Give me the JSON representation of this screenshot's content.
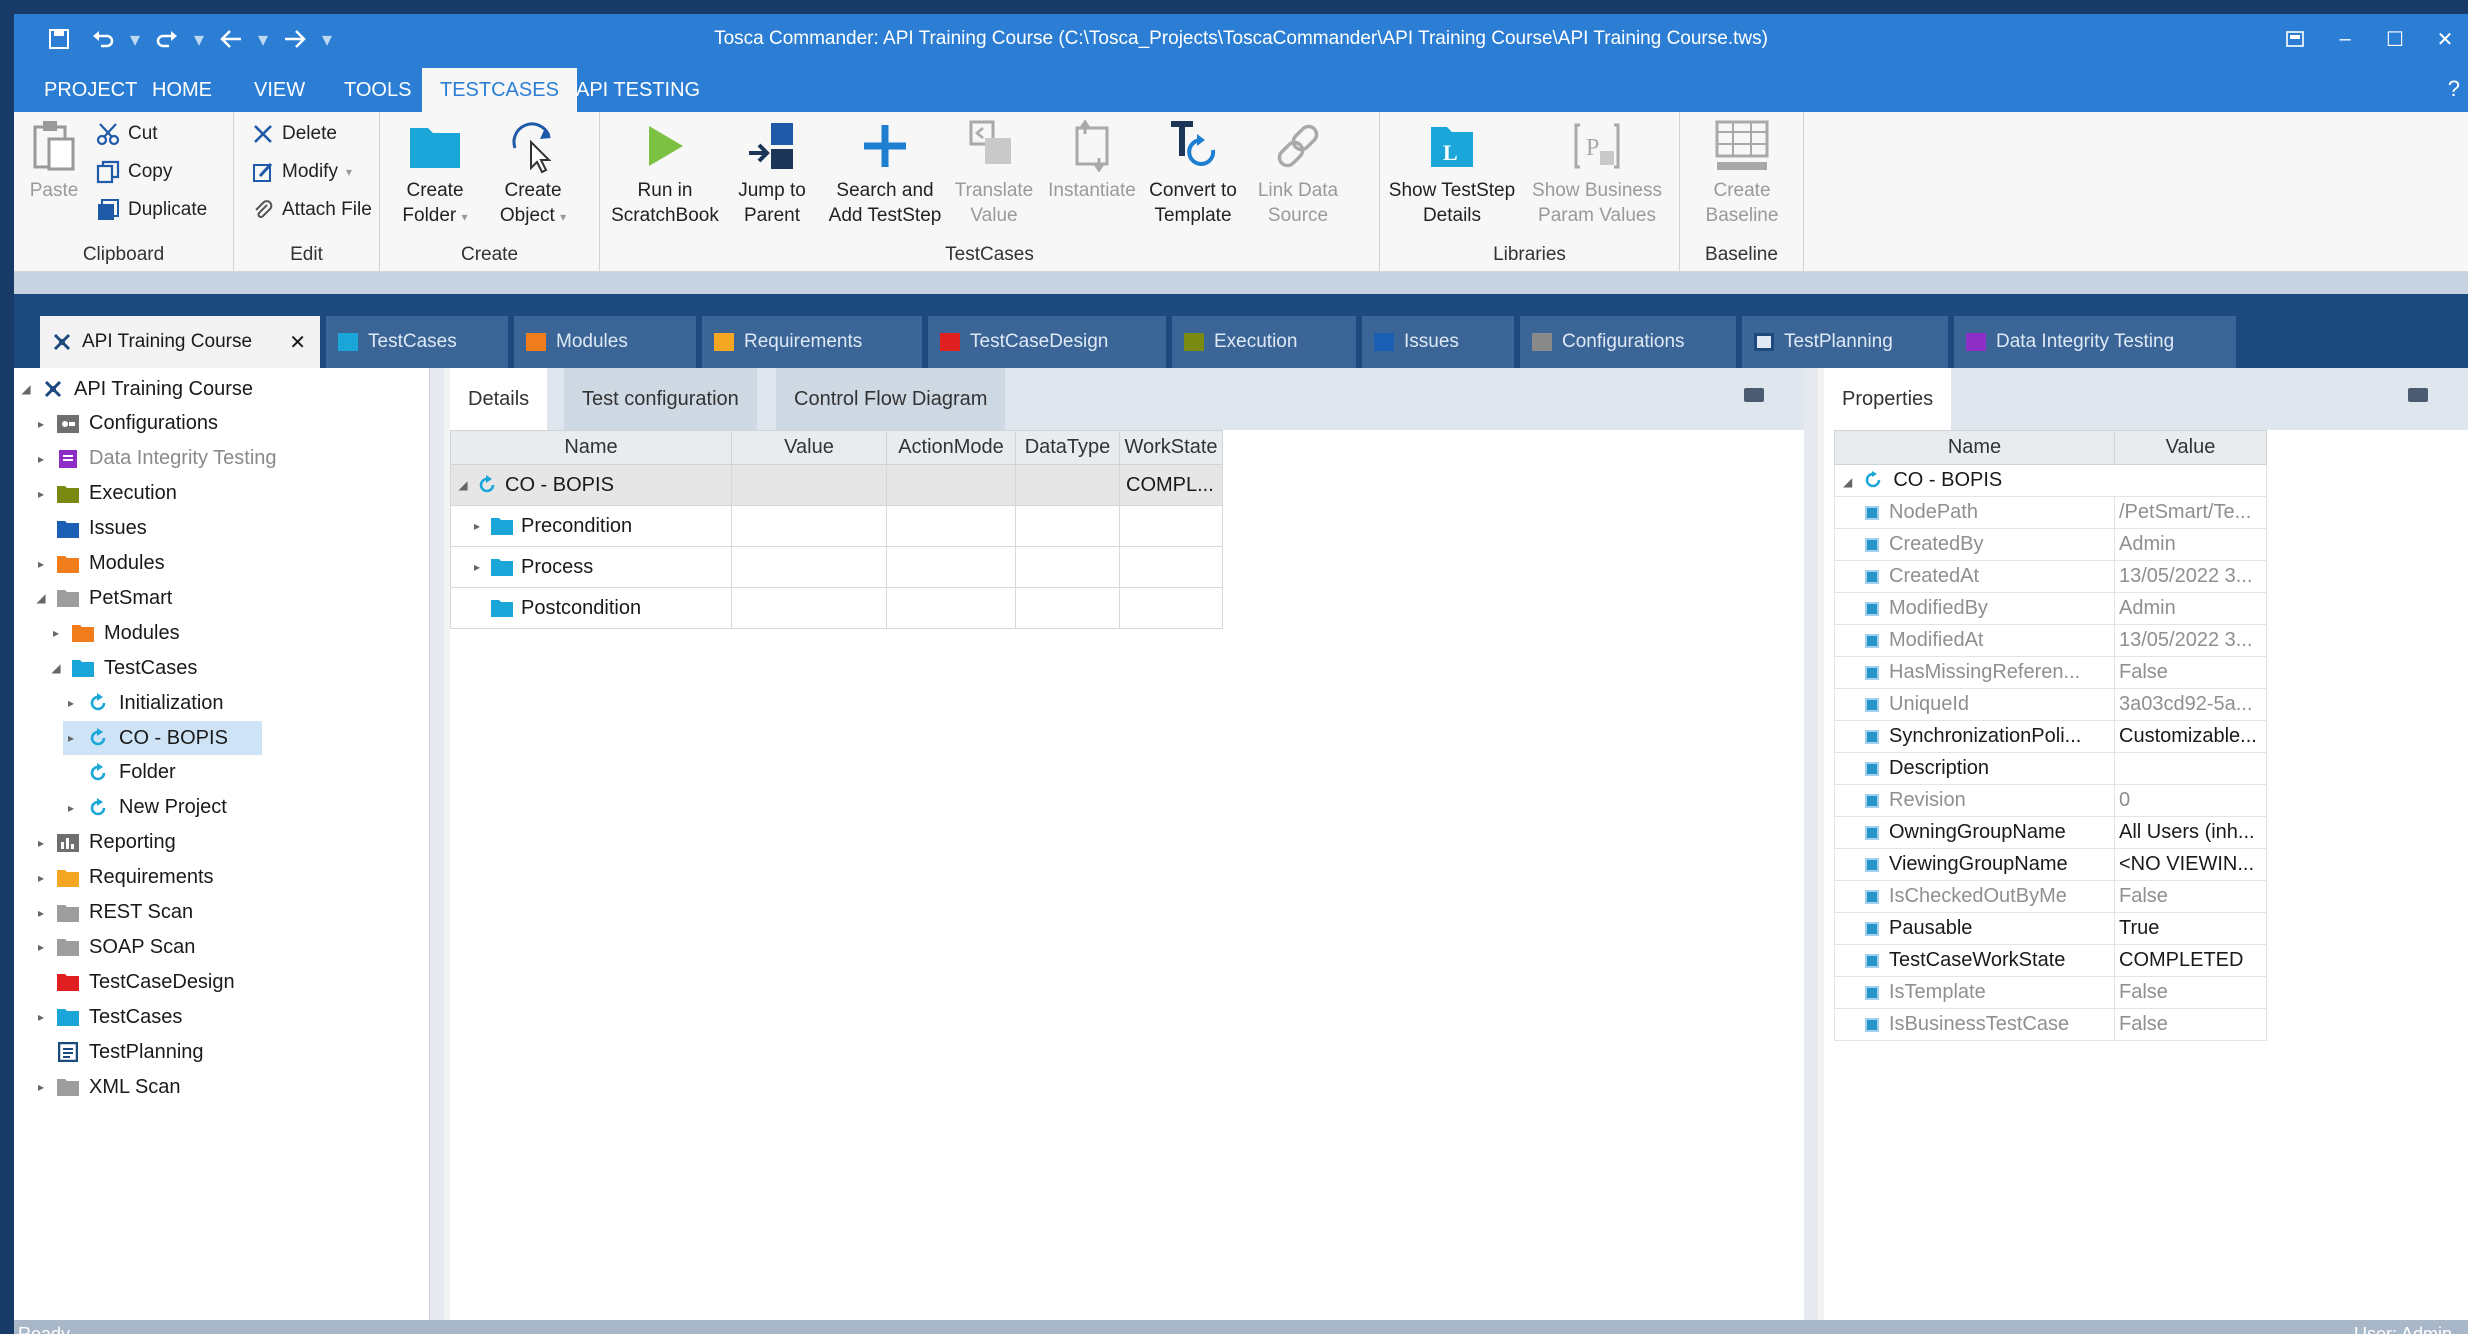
{
  "window": {
    "title": "Tosca Commander: API Training Course (C:\\Tosca_Projects\\ToscaCommander\\API Training Course\\API Training Course.tws)"
  },
  "menu": {
    "tabs": [
      "PROJECT",
      "HOME",
      "VIEW",
      "TOOLS",
      "TESTCASES",
      "API TESTING"
    ],
    "active": "TESTCASES",
    "help": "?"
  },
  "ribbon": {
    "clipboard": {
      "label": "Clipboard",
      "paste": "Paste",
      "cut": "Cut",
      "copy": "Copy",
      "duplicate": "Duplicate"
    },
    "edit": {
      "label": "Edit",
      "delete": "Delete",
      "modify": "Modify",
      "attach": "Attach File"
    },
    "create": {
      "label": "Create",
      "folder": [
        "Create",
        "Folder"
      ],
      "object": [
        "Create",
        "Object"
      ]
    },
    "testcases": {
      "label": "TestCases",
      "run": [
        "Run in",
        "ScratchBook"
      ],
      "jump": [
        "Jump to",
        "Parent"
      ],
      "search": [
        "Search and",
        "Add TestStep"
      ],
      "translate": [
        "Translate",
        "Value"
      ],
      "instantiate": [
        "Instantiate",
        ""
      ],
      "convert": [
        "Convert to",
        "Template"
      ],
      "link": [
        "Link Data",
        "Source"
      ]
    },
    "libraries": {
      "label": "Libraries",
      "show_details": [
        "Show TestStep",
        "Details"
      ],
      "show_business": [
        "Show Business",
        "Param Values"
      ]
    },
    "baseline": {
      "label": "Baseline",
      "create": [
        "Create",
        "Baseline"
      ]
    }
  },
  "doc_tabs": [
    {
      "label": "API Training Course",
      "color": "#1d4a7e"
    },
    {
      "label": "TestCases",
      "color": "#1aa6d8"
    },
    {
      "label": "Modules",
      "color": "#f07c1b"
    },
    {
      "label": "Requirements",
      "color": "#f5a623"
    },
    {
      "label": "TestCaseDesign",
      "color": "#e02020"
    },
    {
      "label": "Execution",
      "color": "#7a8a10"
    },
    {
      "label": "Issues",
      "color": "#1a5fb4"
    },
    {
      "label": "Configurations",
      "color": "#8a8a8a"
    },
    {
      "label": "TestPlanning",
      "color": "#1d4a7e"
    },
    {
      "label": "Data Integrity Testing",
      "color": "#8e2ec6"
    }
  ],
  "tree": [
    {
      "label": "API Training Course",
      "level": 0,
      "expander": "open",
      "icon": "tosca-icon",
      "color": "#1d4a7e"
    },
    {
      "label": "Configurations",
      "level": 1,
      "expander": "closed",
      "icon": "config-folder-icon",
      "color": "#6f6f6f"
    },
    {
      "label": "Data Integrity Testing",
      "level": 1,
      "expander": "closed",
      "icon": "data-integrity-icon",
      "color": "#8e2ec6",
      "grey": true
    },
    {
      "label": "Execution",
      "level": 1,
      "expander": "closed",
      "icon": "folder-icon",
      "color": "#7a8a10"
    },
    {
      "label": "Issues",
      "level": 1,
      "expander": "none",
      "icon": "folder-icon",
      "color": "#1a5fb4"
    },
    {
      "label": "Modules",
      "level": 1,
      "expander": "closed",
      "icon": "folder-icon",
      "color": "#f07c1b"
    },
    {
      "label": "PetSmart",
      "level": 1,
      "expander": "open",
      "icon": "folder-icon",
      "color": "#9e9e9e"
    },
    {
      "label": "Modules",
      "level": 2,
      "expander": "closed",
      "icon": "folder-icon",
      "color": "#f07c1b"
    },
    {
      "label": "TestCases",
      "level": 2,
      "expander": "open",
      "icon": "folder-icon",
      "color": "#1aa6d8"
    },
    {
      "label": "Initialization",
      "level": 3,
      "expander": "closed",
      "icon": "testcase-icon",
      "color": "#1aa6d8"
    },
    {
      "label": "CO - BOPIS",
      "level": 3,
      "expander": "closed",
      "icon": "testcase-icon",
      "color": "#1aa6d8",
      "selected": true
    },
    {
      "label": "Folder",
      "level": 3,
      "expander": "none",
      "icon": "testcase-icon",
      "color": "#1aa6d8"
    },
    {
      "label": "New Project",
      "level": 3,
      "expander": "closed",
      "icon": "testcase-icon",
      "color": "#1aa6d8"
    },
    {
      "label": "Reporting",
      "level": 1,
      "expander": "closed",
      "icon": "reporting-icon",
      "color": "#6f6f6f"
    },
    {
      "label": "Requirements",
      "level": 1,
      "expander": "closed",
      "icon": "folder-icon",
      "color": "#f5a623"
    },
    {
      "label": "REST Scan",
      "level": 1,
      "expander": "closed",
      "icon": "folder-icon",
      "color": "#9e9e9e"
    },
    {
      "label": "SOAP Scan",
      "level": 1,
      "expander": "closed",
      "icon": "folder-icon",
      "color": "#9e9e9e"
    },
    {
      "label": "TestCaseDesign",
      "level": 1,
      "expander": "none",
      "icon": "folder-icon",
      "color": "#e02020"
    },
    {
      "label": "TestCases",
      "level": 1,
      "expander": "closed",
      "icon": "folder-icon",
      "color": "#1aa6d8"
    },
    {
      "label": "TestPlanning",
      "level": 1,
      "expander": "none",
      "icon": "testplanning-icon",
      "color": "#1d4a7e"
    },
    {
      "label": "XML Scan",
      "level": 1,
      "expander": "closed",
      "icon": "folder-icon",
      "color": "#9e9e9e"
    }
  ],
  "details": {
    "tabs": [
      "Details",
      "Test configuration",
      "Control Flow Diagram"
    ],
    "columns": [
      "Name",
      "Value",
      "ActionMode",
      "DataType",
      "WorkState"
    ],
    "rows": [
      {
        "name": "CO - BOPIS",
        "icon": "testcase-icon",
        "expander": "open",
        "indent": 0,
        "value": "",
        "actionmode": "",
        "datatype": "",
        "workstate": "COMPL..."
      },
      {
        "name": "Precondition",
        "icon": "folder-icon",
        "expander": "closed",
        "indent": 1,
        "value": "",
        "actionmode": "",
        "datatype": "",
        "workstate": ""
      },
      {
        "name": "Process",
        "icon": "folder-icon",
        "expander": "closed",
        "indent": 1,
        "value": "",
        "actionmode": "",
        "datatype": "",
        "workstate": ""
      },
      {
        "name": "Postcondition",
        "icon": "folder-icon",
        "expander": "none",
        "indent": 1,
        "value": "",
        "actionmode": "",
        "datatype": "",
        "workstate": ""
      }
    ]
  },
  "properties": {
    "tab": "Properties",
    "columns": [
      "Name",
      "Value"
    ],
    "root": "CO - BOPIS",
    "rows": [
      {
        "name": "NodePath",
        "value": "/PetSmart/Te...",
        "grey": true
      },
      {
        "name": "CreatedBy",
        "value": "Admin",
        "grey": true
      },
      {
        "name": "CreatedAt",
        "value": "13/05/2022 3...",
        "grey": true
      },
      {
        "name": "ModifiedBy",
        "value": "Admin",
        "grey": true
      },
      {
        "name": "ModifiedAt",
        "value": "13/05/2022 3...",
        "grey": true
      },
      {
        "name": "HasMissingReferen...",
        "value": "False",
        "grey": true
      },
      {
        "name": "UniqueId",
        "value": "3a03cd92-5a...",
        "grey": true
      },
      {
        "name": "SynchronizationPoli...",
        "value": "Customizable...",
        "grey": false
      },
      {
        "name": "Description",
        "value": "",
        "grey": false
      },
      {
        "name": "Revision",
        "value": "0",
        "grey": true
      },
      {
        "name": "OwningGroupName",
        "value": "All Users (inh...",
        "grey": false
      },
      {
        "name": "ViewingGroupName",
        "value": "<NO VIEWIN...",
        "grey": false
      },
      {
        "name": "IsCheckedOutByMe",
        "value": "False",
        "grey": true
      },
      {
        "name": "Pausable",
        "value": "True",
        "grey": false
      },
      {
        "name": "TestCaseWorkState",
        "value": "COMPLETED",
        "grey": false
      },
      {
        "name": "IsTemplate",
        "value": "False",
        "grey": true
      },
      {
        "name": "IsBusinessTestCase",
        "value": "False",
        "grey": true
      }
    ]
  },
  "status": {
    "text": "Ready",
    "user": "User: Admin"
  }
}
